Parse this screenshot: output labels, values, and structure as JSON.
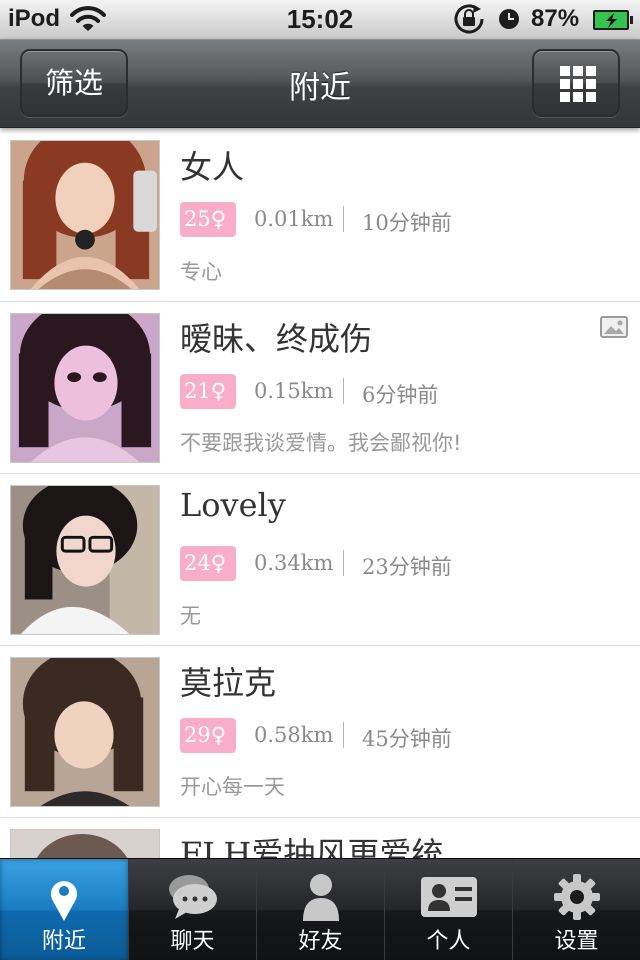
{
  "status_bar": {
    "carrier": "iPod",
    "time": "15:02",
    "battery": "87%",
    "icons": [
      "wifi-icon",
      "rotation-lock-icon",
      "alarm-clock-icon",
      "battery-charging-icon"
    ]
  },
  "nav": {
    "filter_label": "筛选",
    "title": "附近",
    "grid_icon": "grid-icon"
  },
  "users": [
    {
      "name": "女人",
      "age": "25♀",
      "distance": "0.01km",
      "time": "10分钟前",
      "signature": "专心",
      "has_photo": false
    },
    {
      "name": "暧昧、终成伤",
      "age": "21♀",
      "distance": "0.15km",
      "time": "6分钟前",
      "signature": "不要跟我谈爱情。我会鄙视你!",
      "has_photo": true
    },
    {
      "name": "Lovely",
      "age": "24♀",
      "distance": "0.34km",
      "time": "23分钟前",
      "signature": "无",
      "has_photo": false
    },
    {
      "name": "莫拉克",
      "age": "29♀",
      "distance": "0.58km",
      "time": "45分钟前",
      "signature": "开心每一天",
      "has_photo": false
    },
    {
      "name": "FLH爱抽风更爱统"
    }
  ],
  "tabs": [
    {
      "label": "附近",
      "icon": "location-pin-icon",
      "active": true
    },
    {
      "label": "聊天",
      "icon": "chat-bubbles-icon",
      "active": false
    },
    {
      "label": "好友",
      "icon": "person-icon",
      "active": false
    },
    {
      "label": "个人",
      "icon": "profile-card-icon",
      "active": false
    },
    {
      "label": "设置",
      "icon": "gear-icon",
      "active": false
    }
  ],
  "colors": {
    "age_badge": "#f8aec8",
    "active_tab": "#1a7cc2",
    "nav_bar": "#4a4c50"
  }
}
